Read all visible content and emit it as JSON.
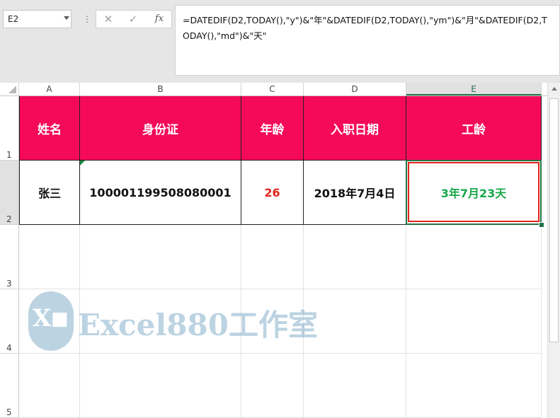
{
  "name_box": "E2",
  "formula_bar": {
    "fx_label": "fx",
    "formula": "=DATEDIF(D2,TODAY(),\"y\")&\"年\"&DATEDIF(D2,TODAY(),\"ym\")&\"月\"&DATEDIF(D2,TODAY(),\"md\")&\"天\""
  },
  "columns": [
    "A",
    "B",
    "C",
    "D",
    "E"
  ],
  "rows": [
    "1",
    "2",
    "3",
    "4",
    "5"
  ],
  "headers": [
    "姓名",
    "身份证",
    "年龄",
    "入职日期",
    "工龄"
  ],
  "record": [
    "张三",
    "100001199508080001",
    "26",
    "2018年7月4日",
    "3年7月23天"
  ],
  "colors": {
    "header_fill": "#f50a5a",
    "age_text": "#e2231a",
    "tenure_text": "#19a84a",
    "selection": "#217346"
  },
  "watermark": {
    "brand": "Excel880工作室",
    "logo_letter": "X"
  }
}
